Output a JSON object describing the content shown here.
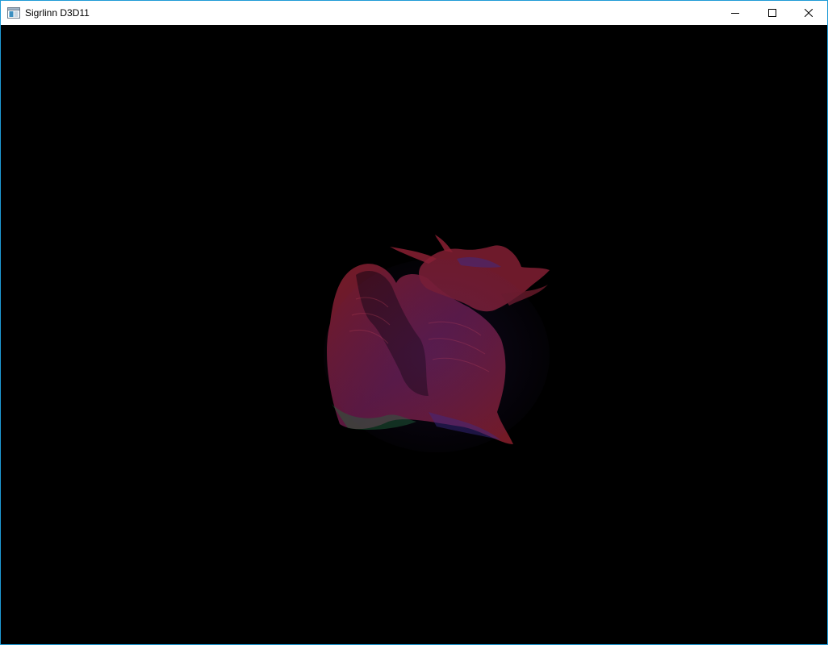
{
  "window": {
    "title": "Sigrlinn D3D11",
    "app_icon": "window-app-icon",
    "controls": {
      "minimize_icon": "minimize-icon",
      "maximize_icon": "maximize-icon",
      "close_icon": "close-icon"
    },
    "frame_color": "#1f9bd6"
  },
  "viewport": {
    "background": "#000000",
    "model": "dragon-model",
    "colors": {
      "body": "#8a1f2a",
      "tint_blue": "#3a2a8a",
      "tint_green": "#1f6a3a"
    }
  }
}
